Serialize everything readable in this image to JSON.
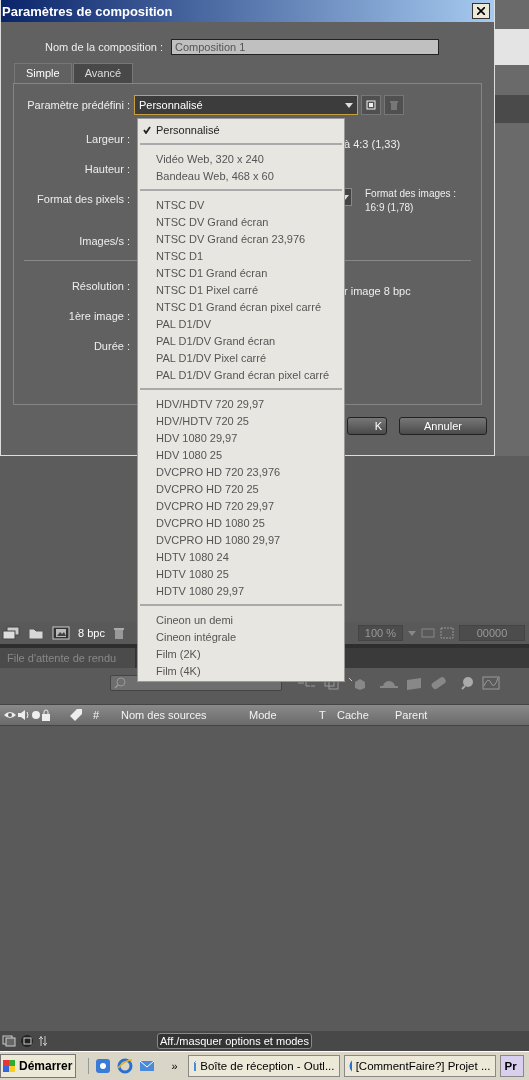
{
  "dialog": {
    "title": "Paramètres de composition",
    "name_label": "Nom de la composition :",
    "name_value": "Composition 1",
    "tabs": [
      {
        "label": "Simple",
        "selected": true
      },
      {
        "label": "Avancé",
        "selected": false
      }
    ],
    "preset_label": "Paramètre prédéfini :",
    "preset_value": "Personnalisé",
    "fields": [
      {
        "label": "Largeur :",
        "aside": "à 4:3 (1,33)"
      },
      {
        "label": "Hauteur :"
      },
      {
        "label": "Format des pixels :",
        "kind": "dropdown",
        "aside": "Format des images :",
        "aside2": "16:9 (1,78)"
      },
      {
        "label": "Images/s :"
      },
      {
        "kind": "divider"
      },
      {
        "label": "Résolution :",
        "aside": "r image 8 bpc"
      },
      {
        "label": "1ère image :"
      },
      {
        "label": "Durée :"
      }
    ],
    "buttons": [
      "K",
      "Annuler"
    ]
  },
  "preset_menu": {
    "groups": [
      [
        {
          "label": "Personnalisé",
          "checked": true
        }
      ],
      [
        {
          "label": "Vidéo Web, 320 x 240",
          "checked": false
        },
        {
          "label": "Bandeau Web, 468 x 60",
          "checked": false
        }
      ],
      [
        {
          "label": "NTSC DV",
          "checked": false
        },
        {
          "label": "NTSC DV Grand écran",
          "checked": false
        },
        {
          "label": "NTSC DV Grand écran 23,976",
          "checked": false
        },
        {
          "label": "NTSC D1",
          "checked": false
        },
        {
          "label": "NTSC D1 Grand écran",
          "checked": false
        },
        {
          "label": "NTSC D1 Pixel carré",
          "checked": false
        },
        {
          "label": "NTSC D1 Grand écran pixel carré",
          "checked": false
        },
        {
          "label": "PAL D1/DV",
          "checked": false
        },
        {
          "label": "PAL D1/DV Grand écran",
          "checked": false
        },
        {
          "label": "PAL D1/DV Pixel carré",
          "checked": false
        },
        {
          "label": "PAL D1/DV Grand écran pixel carré",
          "checked": false
        }
      ],
      [
        {
          "label": "HDV/HDTV 720 29,97",
          "checked": false
        },
        {
          "label": "HDV/HDTV 720 25",
          "checked": false
        },
        {
          "label": "HDV 1080 29,97",
          "checked": false
        },
        {
          "label": "HDV 1080 25",
          "checked": false
        },
        {
          "label": "DVCPRO HD 720 23,976",
          "checked": false
        },
        {
          "label": "DVCPRO HD 720 25",
          "checked": false
        },
        {
          "label": "DVCPRO HD 720 29,97",
          "checked": false
        },
        {
          "label": "DVCPRO HD 1080 25",
          "checked": false
        },
        {
          "label": "DVCPRO HD 1080 29,97",
          "checked": false
        },
        {
          "label": "HDTV 1080 24",
          "checked": false
        },
        {
          "label": "HDTV 1080 25",
          "checked": false
        },
        {
          "label": "HDTV 1080 29,97",
          "checked": false
        }
      ],
      [
        {
          "label": "Cineon un demi",
          "checked": false
        },
        {
          "label": "Cineon intégrale",
          "checked": false
        },
        {
          "label": "Film (2K)",
          "checked": false
        },
        {
          "label": "Film (4K)",
          "checked": false
        }
      ]
    ]
  },
  "project_toolbar": {
    "bit_depth": "8 bpc",
    "zoom": "100 %",
    "timecode": "00000"
  },
  "render_tab": {
    "label": "File d'attente de rendu",
    "selected": false
  },
  "timeline": {
    "columns": [
      "#",
      "Nom des sources",
      "Mode",
      "T",
      "Cache",
      "Parent"
    ],
    "tooltip": "Aff./masquer options et modes"
  },
  "taskbar": {
    "start": "Démarrer",
    "more": "»",
    "tasks": [
      "Boîte de réception - Outl...",
      "[CommentFaire?] Projet ...",
      "Pr"
    ]
  }
}
